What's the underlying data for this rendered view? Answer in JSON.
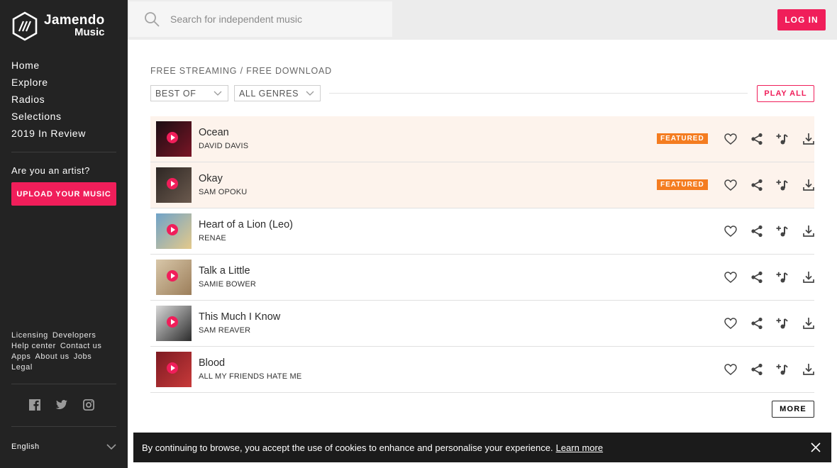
{
  "brand": {
    "name_line1": "Jamendo",
    "name_line2": "Music"
  },
  "sidebar": {
    "nav": [
      {
        "label": "Home"
      },
      {
        "label": "Explore"
      },
      {
        "label": "Radios"
      },
      {
        "label": "Selections"
      },
      {
        "label": "2019 In Review"
      }
    ],
    "artist_question": "Are you an artist?",
    "upload_label": "UPLOAD YOUR MUSIC",
    "footer_links": [
      "Licensing",
      "Developers",
      "Help center",
      "Contact us",
      "Apps",
      "About us",
      "Jobs",
      "Legal"
    ],
    "social_icons": [
      "facebook-icon",
      "twitter-icon",
      "instagram-icon"
    ],
    "language": "English"
  },
  "topbar": {
    "search_placeholder": "Search for independent music",
    "login_label": "LOG IN"
  },
  "main": {
    "heading": "FREE STREAMING / FREE DOWNLOAD",
    "filter_period": "BEST OF",
    "filter_genre": "ALL GENRES",
    "play_all_label": "PLAY ALL",
    "featured_label": "FEATURED",
    "more_label": "MORE",
    "tracks": [
      {
        "title": "Ocean",
        "artist": "DAVID DAVIS",
        "featured": true,
        "cover": [
          "#1a0d12",
          "#7a1526"
        ]
      },
      {
        "title": "Okay",
        "artist": "SAM OPOKU",
        "featured": true,
        "cover": [
          "#2d2623",
          "#6b5a4e"
        ]
      },
      {
        "title": "Heart of a Lion (Leo)",
        "artist": "RENAE",
        "featured": false,
        "cover": [
          "#6fa3c9",
          "#e4c98a"
        ]
      },
      {
        "title": "Talk a Little",
        "artist": "SAMIE BOWER",
        "featured": false,
        "cover": [
          "#d8c7a9",
          "#9c7e5a"
        ]
      },
      {
        "title": "This Much I Know",
        "artist": "SAM REAVER",
        "featured": false,
        "cover": [
          "#d9d9d9",
          "#2c2c2c"
        ]
      },
      {
        "title": "Blood",
        "artist": "ALL MY FRIENDS HATE ME",
        "featured": false,
        "cover": [
          "#7d1a22",
          "#c83a3a"
        ]
      }
    ]
  },
  "cookie": {
    "text": "By continuing to browse, you accept the use of cookies to enhance and personalise your experience.",
    "link": "Learn more"
  },
  "colors": {
    "accent": "#f01e5a",
    "featured_badge": "#f47c20",
    "sidebar_bg": "#232323",
    "featured_row_bg": "#fdf3ec"
  }
}
